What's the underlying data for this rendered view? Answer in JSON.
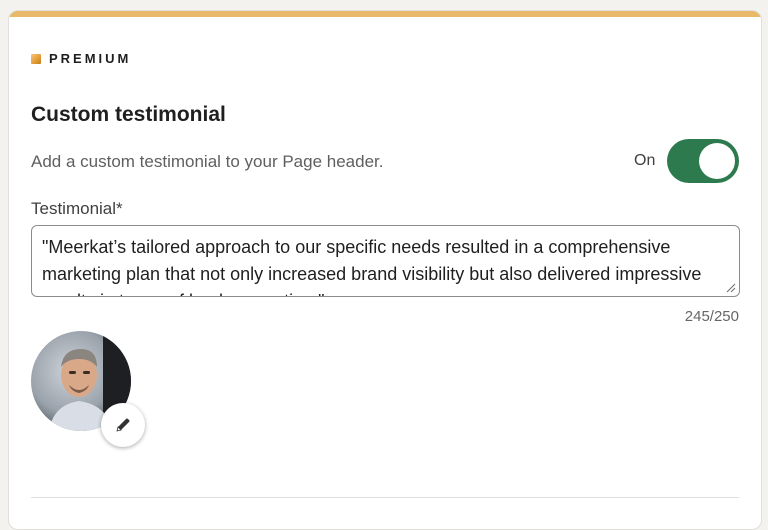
{
  "premium": {
    "label": "PREMIUM",
    "icon": "premium-gold-square-icon"
  },
  "section": {
    "title": "Custom testimonial",
    "description": "Add a custom testimonial to your Page header."
  },
  "toggle": {
    "state_label": "On",
    "is_on": true,
    "color": "#2d7a4f"
  },
  "testimonial_field": {
    "label": "Testimonial*",
    "value": "\"Meerkat’s tailored approach to our specific needs resulted in a comprehensive marketing plan that not only increased brand visibility but also delivered impressive results in terms of lead generation.\"",
    "char_count": "245/250"
  },
  "avatar": {
    "icon": "person-avatar",
    "edit_icon": "pencil-icon"
  },
  "colors": {
    "accent_bar": "#e9b96a",
    "toggle_on": "#2d7a4f"
  }
}
